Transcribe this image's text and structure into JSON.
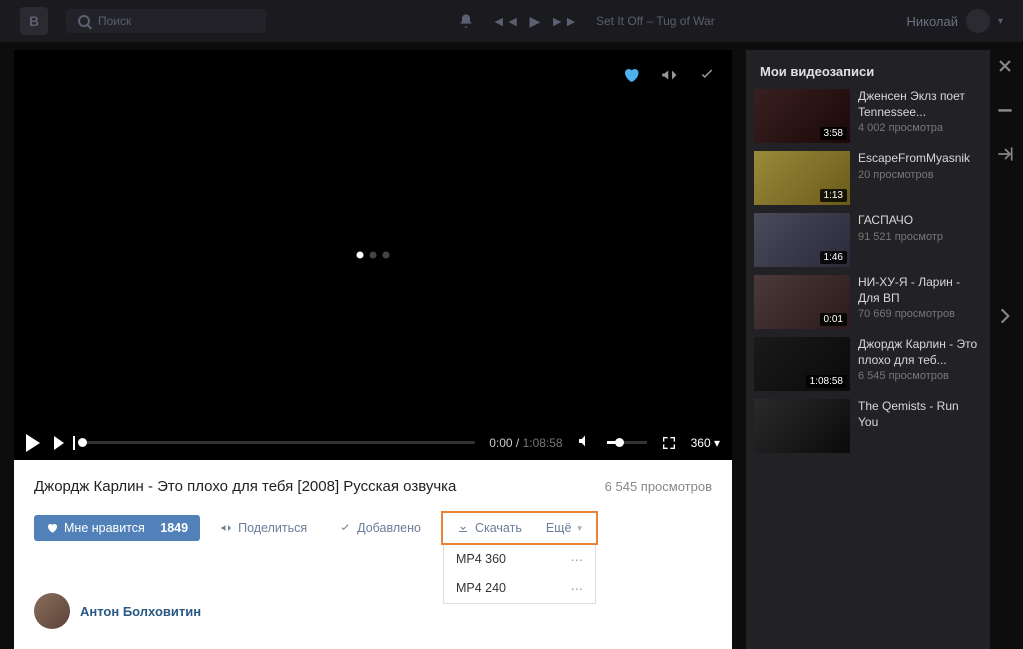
{
  "topbar": {
    "search_placeholder": "Поиск",
    "track": "Set It Off – Tug of War",
    "username": "Николай"
  },
  "player": {
    "current_time": "0:00",
    "total_time": "1:08:58",
    "quality": "360"
  },
  "video": {
    "title": "Джордж Карлин - Это плохо для тебя [2008] Русская озвучка",
    "views": "6 545 просмотров"
  },
  "buttons": {
    "like": "Мне нравится",
    "like_count": "1849",
    "share": "Поделиться",
    "added": "Добавлено",
    "download": "Скачать",
    "more": "Ещё"
  },
  "downloads": [
    "MP4 360",
    "MP4 240"
  ],
  "author": "Антон Болховитин",
  "sidebar": {
    "title": "Мои видеозаписи",
    "items": [
      {
        "title": "Дженсен Эклз поет Tennessee...",
        "views": "4 002 просмотра",
        "dur": "3:58"
      },
      {
        "title": "EscapeFromMyasnik",
        "views": "20 просмотров",
        "dur": "1:13"
      },
      {
        "title": "ГАСПАЧО",
        "views": "91 521 просмотр",
        "dur": "1:46"
      },
      {
        "title": "НИ-ХУ-Я - Ларин - Для ВП",
        "views": "70 669 просмотров",
        "dur": "0:01"
      },
      {
        "title": "Джордж Карлин - Это плохо для теб...",
        "views": "6 545 просмотров",
        "dur": "1:08:58"
      },
      {
        "title": "The Qemists - Run You",
        "views": "",
        "dur": ""
      }
    ]
  }
}
